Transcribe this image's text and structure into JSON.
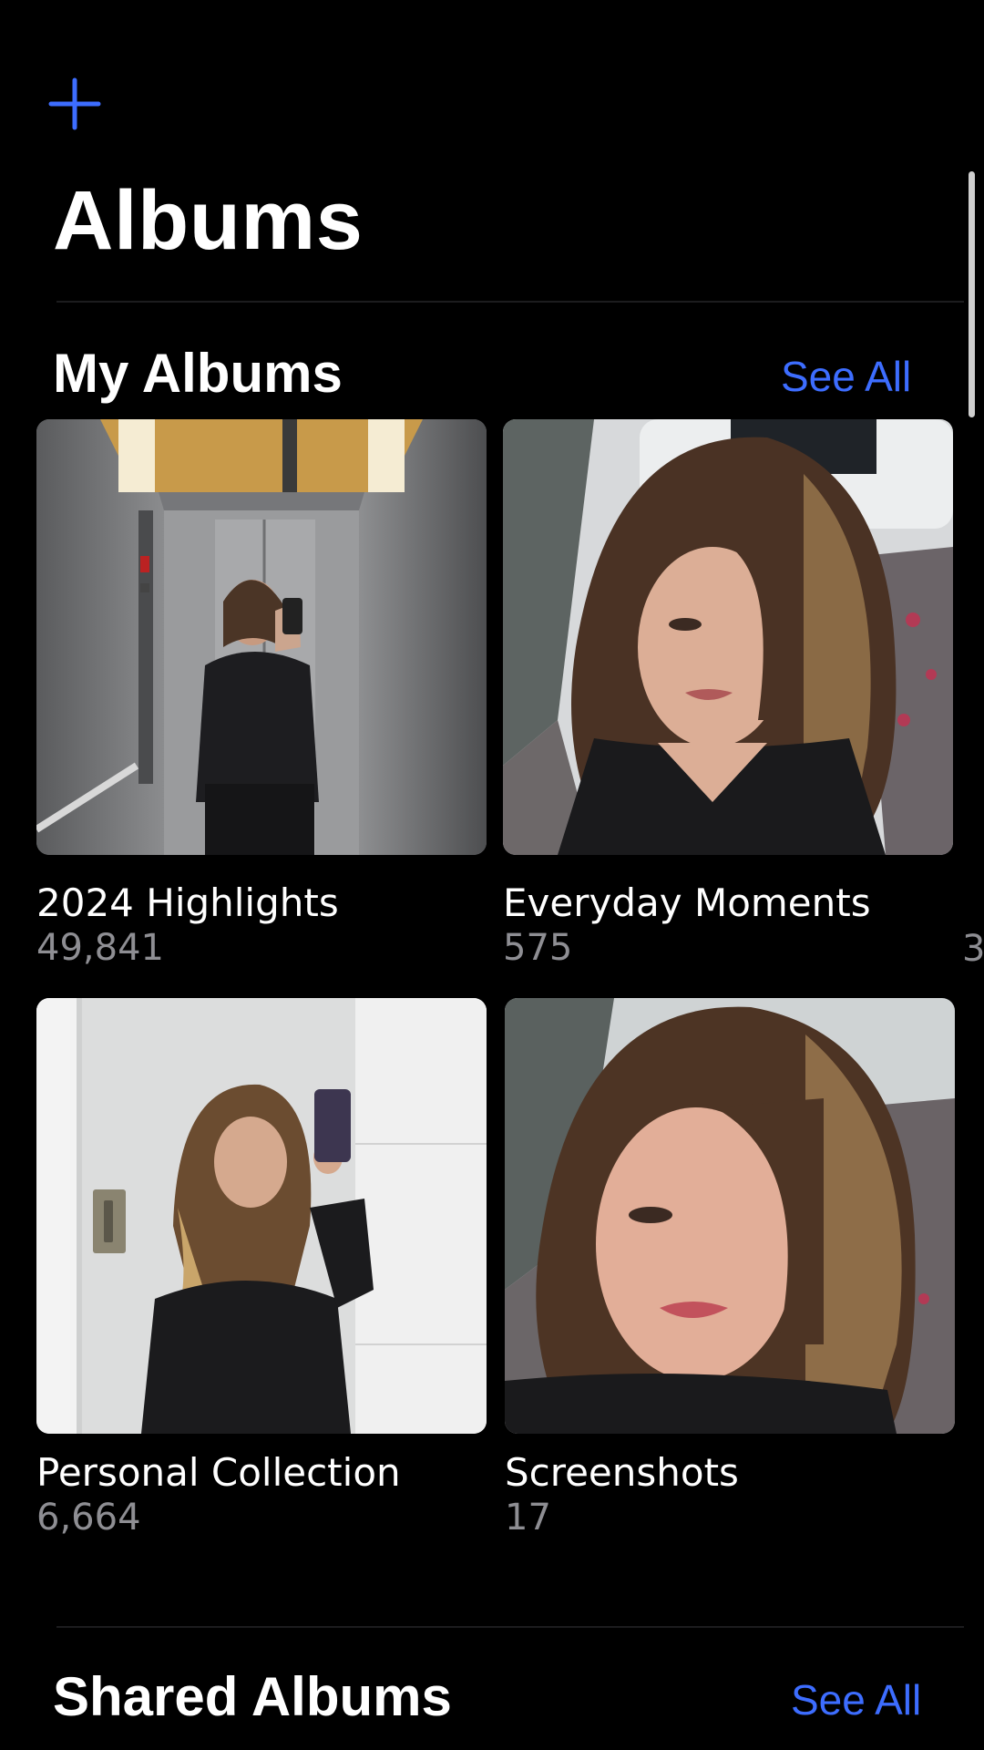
{
  "header": {
    "add_icon": "plus-icon",
    "title": "Albums"
  },
  "my_albums": {
    "title": "My Albums",
    "see_all": "See All",
    "albums": [
      {
        "name": "2024 Highlights",
        "count": "49,841",
        "thumb": "selfie in elevator"
      },
      {
        "name": "Everyday Moments",
        "count": "575",
        "thumb": "selfie on train seat"
      },
      {
        "name": "Personal Collection",
        "count": "6,664",
        "thumb": "mirror selfie in white room"
      },
      {
        "name": "Screenshots",
        "count": "17",
        "thumb": "close-up selfie on train"
      }
    ],
    "next_column_count_peek": "3"
  },
  "shared_albums": {
    "title": "Shared Albums",
    "see_all": "See All"
  },
  "colors": {
    "background": "#000000",
    "accent": "#3d6dff",
    "secondary_text": "#8e8e93"
  }
}
